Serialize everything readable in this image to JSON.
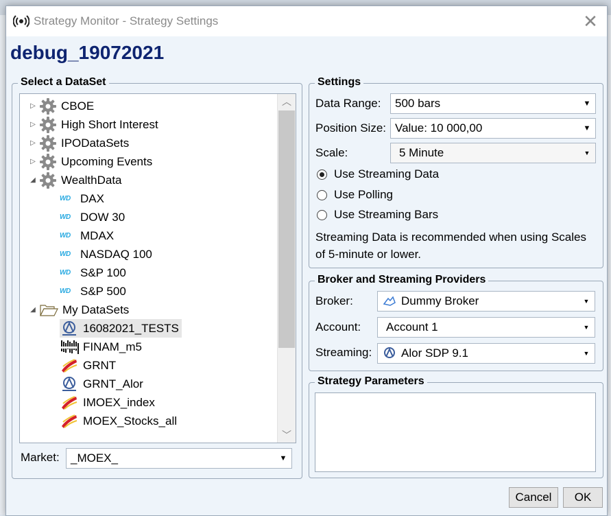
{
  "window": {
    "title": "Strategy Monitor - Strategy Settings",
    "close_glyph": "✕"
  },
  "strategy_name": "debug_19072021",
  "dataset_panel": {
    "title": "Select a DataSet",
    "tree": [
      {
        "label": "CBOE",
        "icon": "gear-icon",
        "expander": "▷",
        "indent": 0
      },
      {
        "label": "High Short Interest",
        "icon": "gear-icon",
        "expander": "▷",
        "indent": 0
      },
      {
        "label": "IPODataSets",
        "icon": "gear-icon",
        "expander": "▷",
        "indent": 0
      },
      {
        "label": "Upcoming Events",
        "icon": "gear-icon",
        "expander": "▷",
        "indent": 0
      },
      {
        "label": "WealthData",
        "icon": "gear-icon",
        "expander": "◢",
        "indent": 0
      },
      {
        "label": "DAX",
        "icon": "wd-icon",
        "indent": 1
      },
      {
        "label": "DOW 30",
        "icon": "wd-icon",
        "indent": 1
      },
      {
        "label": "MDAX",
        "icon": "wd-icon",
        "indent": 1
      },
      {
        "label": "NASDAQ 100",
        "icon": "wd-icon",
        "indent": 1
      },
      {
        "label": "S&P 100",
        "icon": "wd-icon",
        "indent": 1
      },
      {
        "label": "S&P 500",
        "icon": "wd-icon",
        "indent": 1
      },
      {
        "label": "My DataSets",
        "icon": "folder-open-icon",
        "expander": "◢",
        "indent": 0
      },
      {
        "label": "16082021_TESTS",
        "icon": "alor-icon",
        "indent": 1,
        "selected": true
      },
      {
        "label": "FINAM_m5",
        "icon": "finam-icon",
        "indent": 1
      },
      {
        "label": "GRNT",
        "icon": "moex-icon",
        "indent": 1
      },
      {
        "label": "GRNT_Alor",
        "icon": "alor-icon",
        "indent": 1
      },
      {
        "label": "IMOEX_index",
        "icon": "moex-icon",
        "indent": 1
      },
      {
        "label": "MOEX_Stocks_all",
        "icon": "moex-icon",
        "indent": 1
      }
    ],
    "market_label": "Market:",
    "market_value": "_MOEX_"
  },
  "settings": {
    "title": "Settings",
    "data_range_label": "Data Range:",
    "data_range_value": "500 bars",
    "position_size_label": "Position Size:",
    "position_size_value": "Value: 10 000,00",
    "scale_label": "Scale:",
    "scale_value": "5 Minute",
    "radios": [
      {
        "label": "Use Streaming Data",
        "checked": true
      },
      {
        "label": "Use Polling",
        "checked": false
      },
      {
        "label": "Use Streaming Bars",
        "checked": false
      }
    ],
    "note_line1": "Streaming Data is recommended when using Scales",
    "note_line2": "of 5-minute or lower."
  },
  "providers": {
    "title": "Broker and Streaming Providers",
    "broker_label": "Broker:",
    "broker_value": "Dummy Broker",
    "account_label": "Account:",
    "account_value": "Account 1",
    "streaming_label": "Streaming:",
    "streaming_value": "Alor SDP 9.1"
  },
  "params": {
    "title": "Strategy Parameters"
  },
  "buttons": {
    "cancel": "Cancel",
    "ok": "OK"
  },
  "colors": {
    "title_blue": "#0e2470",
    "wd_blue": "#27a9e1",
    "moex_red": "#d4202a"
  }
}
